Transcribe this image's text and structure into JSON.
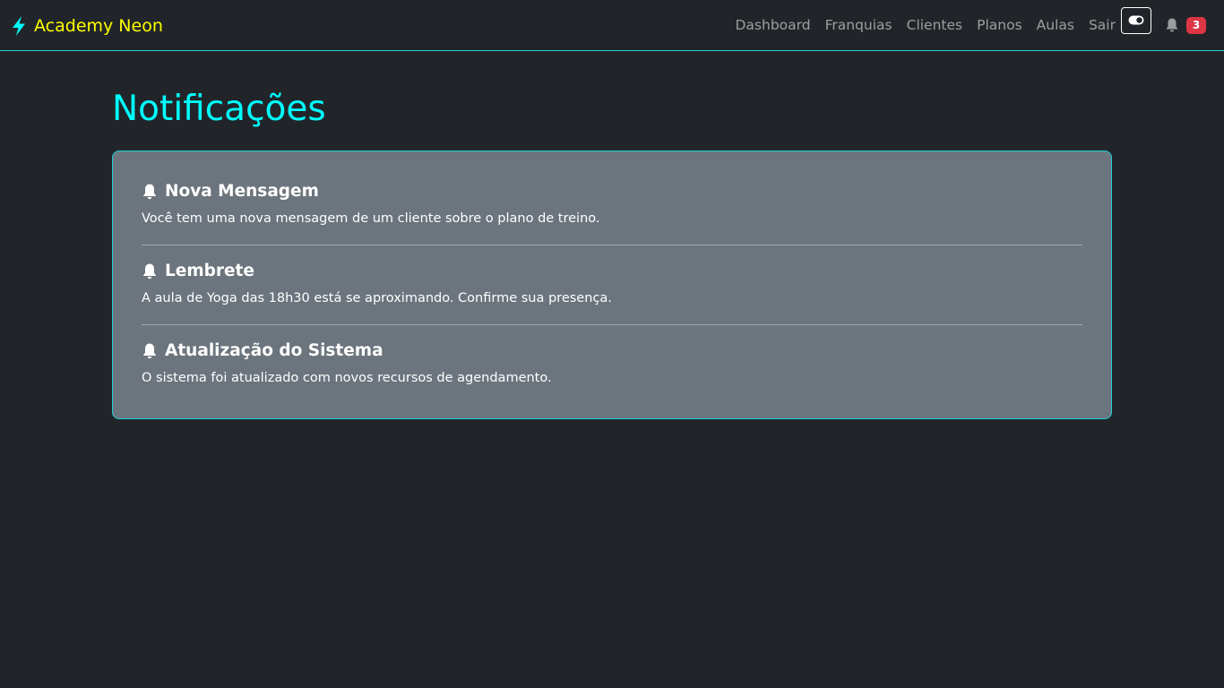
{
  "colors": {
    "background": "#212529",
    "brand": "#ffff00",
    "accent": "#00ffff",
    "card_border": "#1fd3d3",
    "card_background": "#6c757d",
    "badge": "#dc3545"
  },
  "navbar": {
    "brand_icon": "lightning-bolt-icon",
    "brand_name": "Academy Neon",
    "links": [
      "Dashboard",
      "Franquias",
      "Clientes",
      "Planos",
      "Aulas",
      "Sair"
    ],
    "theme_toggle_icon": "toggle-icon",
    "notifications_icon": "bell-icon",
    "notification_count": "3"
  },
  "main": {
    "title": "Notificações",
    "notifications": [
      {
        "icon": "bell-icon",
        "title": "Nova Mensagem",
        "text": "Você tem uma nova mensagem de um cliente sobre o plano de treino."
      },
      {
        "icon": "bell-icon",
        "title": "Lembrete",
        "text": "A aula de Yoga das 18h30 está se aproximando. Confirme sua presença."
      },
      {
        "icon": "bell-icon",
        "title": "Atualização do Sistema",
        "text": "O sistema foi atualizado com novos recursos de agendamento."
      }
    ]
  }
}
